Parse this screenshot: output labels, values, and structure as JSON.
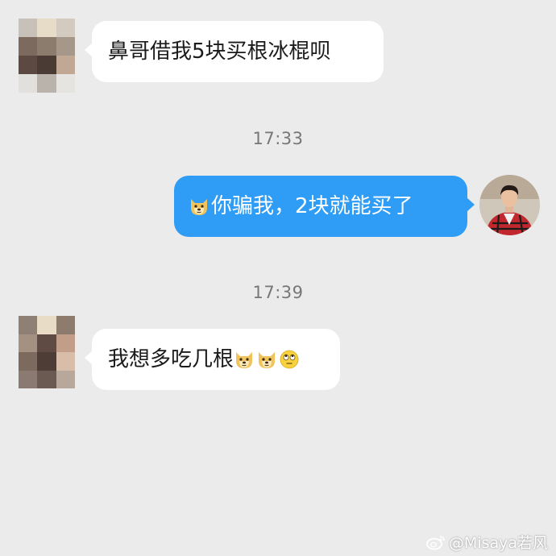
{
  "conversation": {
    "messages": [
      {
        "sender": "other",
        "text": "鼻哥借我5块买根冰棍呗"
      },
      {
        "sender": "self",
        "prefix_emoji": "doge-icon",
        "text": "你骗我，2块就能买了"
      },
      {
        "sender": "other",
        "text": "我想多吃几根",
        "suffix_emoji": [
          "doge-icon",
          "doge-icon",
          "eye-roll-icon"
        ]
      }
    ],
    "timestamps": [
      "17:33",
      "17:39"
    ]
  },
  "colors": {
    "background": "#ebebeb",
    "incoming_bubble": "#ffffff",
    "outgoing_bubble": "#2f9cf6",
    "timestamp_text": "#777777"
  },
  "watermark": {
    "text": "@Misaya若风",
    "icon": "weibo-icon"
  }
}
